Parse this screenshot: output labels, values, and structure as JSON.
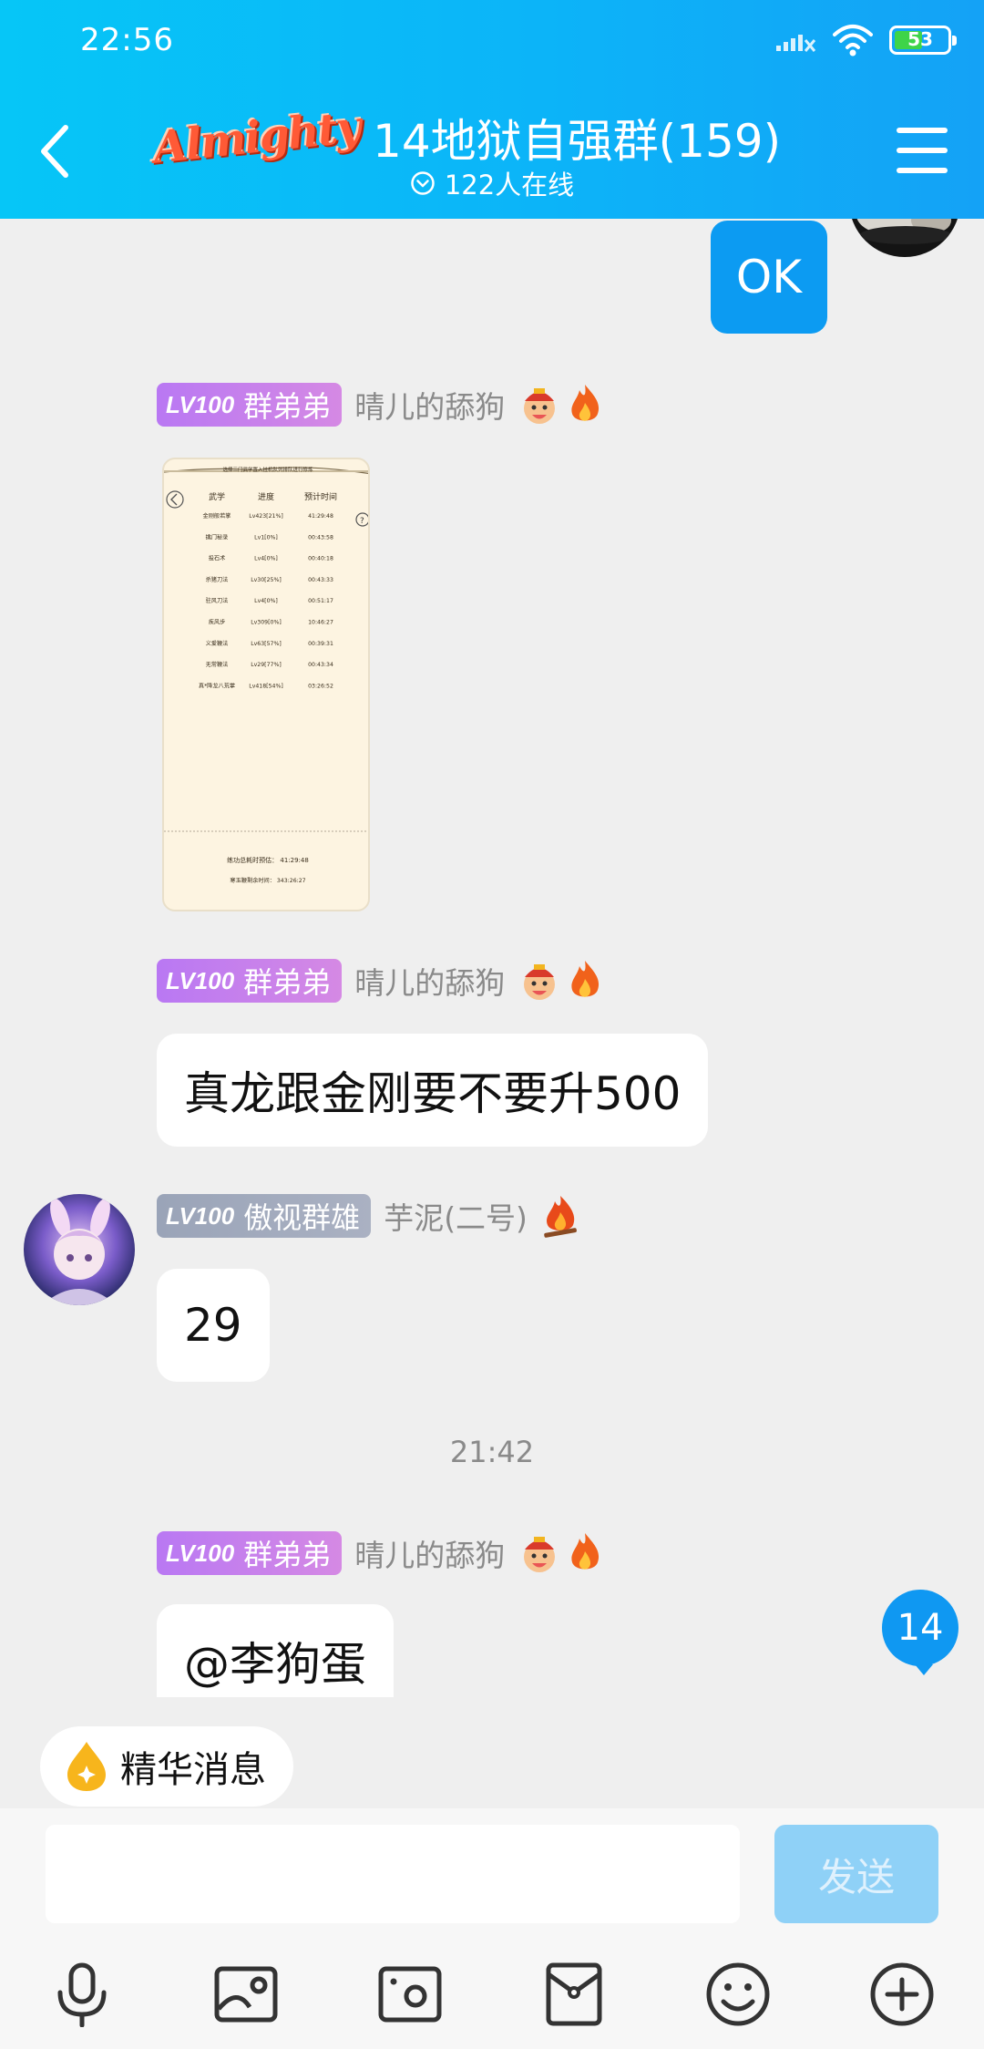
{
  "status_bar": {
    "time": "22:56",
    "battery": "53",
    "battery_level": 0.53
  },
  "header": {
    "logo_text": "Almighty",
    "title": "14地狱自强群(159)",
    "online": "122人在线"
  },
  "messages": [
    {
      "type": "text",
      "side": "right",
      "text": "OK"
    },
    {
      "type": "image",
      "side": "left",
      "level": "LV100",
      "title": "群弟弟",
      "sender": "晴儿的舔狗",
      "image": {
        "header": "选择三门武学置入挂机队列排队进行修炼",
        "columns": [
          "武学",
          "进度",
          "预计时间"
        ],
        "rows": [
          [
            "金刚般若掌",
            "Lv423[21%]",
            "41:29:48"
          ],
          [
            "擒门秘录",
            "Lv1[0%]",
            "00:43:58"
          ],
          [
            "投石术",
            "Lv4[0%]",
            "00:40:18"
          ],
          [
            "杀猪刀法",
            "Lv30[25%]",
            "00:43:33"
          ],
          [
            "驻风刀法",
            "Lv4[0%]",
            "00:51:17"
          ],
          [
            "疾风步",
            "Lv309[0%]",
            "10:46:27"
          ],
          [
            "义爱鞭法",
            "Lv63[57%]",
            "00:39:31"
          ],
          [
            "无常鞭法",
            "Lv29[77%]",
            "00:43:34"
          ],
          [
            "真*降龙八荒掌",
            "Lv418[54%]",
            "03:26:52"
          ]
        ],
        "total_label": "练功总耗时预估：",
        "total_value": "41:29:48",
        "remain_label": "寒玉鞭剩余时间：",
        "remain_value": "343:26:27"
      }
    },
    {
      "type": "text",
      "side": "left",
      "level": "LV100",
      "title": "群弟弟",
      "sender": "晴儿的舔狗",
      "text": "真龙跟金刚要不要升500"
    },
    {
      "type": "text",
      "side": "left",
      "level": "LV100",
      "title": "傲视群雄",
      "sender": "芋泥(二号)",
      "text": "29"
    },
    {
      "type": "time",
      "text": "21:42"
    },
    {
      "type": "text",
      "side": "left",
      "level": "LV100",
      "title": "群弟弟",
      "sender": "晴儿的舔狗",
      "text": "@李狗蛋"
    }
  ],
  "unread_count": "14",
  "essence": {
    "label": "精华消息"
  },
  "input": {
    "value": "",
    "send_label": "发送"
  },
  "toolbar_icons": [
    "microphone-icon",
    "picture-icon",
    "camera-icon",
    "red-packet-icon",
    "emoji-icon",
    "plus-icon"
  ],
  "colors": {
    "header_start": "#06c6f7",
    "header_end": "#14a2f6",
    "bubble_self": "#0c9bf2",
    "badge_purple": "#b978f3",
    "badge_grey": "#9aa4b8",
    "send_disabled": "#8fd1f7"
  }
}
